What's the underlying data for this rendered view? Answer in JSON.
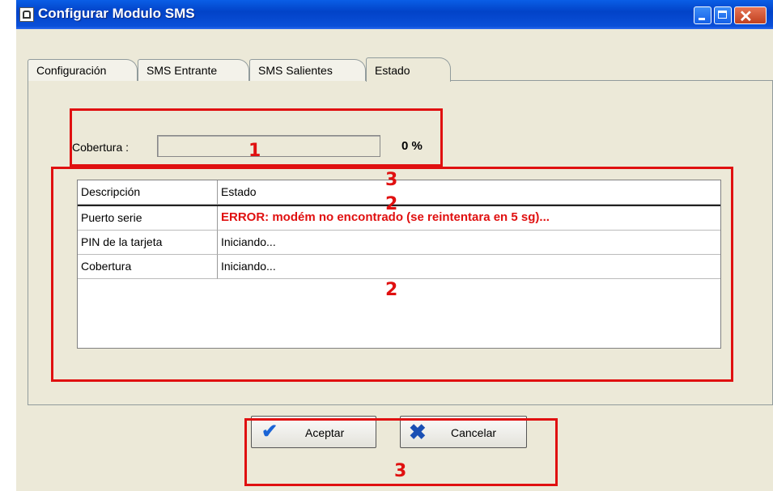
{
  "window": {
    "title": "Configurar Modulo SMS",
    "close_glyph": "✕"
  },
  "tabs": [
    {
      "label": "Configuración"
    },
    {
      "label": "SMS Entrante"
    },
    {
      "label": "SMS Salientes"
    },
    {
      "label": "Estado",
      "active": true
    }
  ],
  "cobertura": {
    "label": "Cobertura :",
    "value_percent": 0,
    "value_text": "0 %"
  },
  "grid": {
    "columns": [
      "Descripción",
      "Estado"
    ],
    "rows": [
      {
        "descripcion": "Puerto serie",
        "estado": "ERROR: modém no encontrado (se reintentara en 5 sg)...",
        "error": true
      },
      {
        "descripcion": "PIN de la tarjeta",
        "estado": "Iniciando..."
      },
      {
        "descripcion": "Cobertura",
        "estado": "Iniciando..."
      }
    ]
  },
  "buttons": {
    "accept": {
      "label": "Aceptar",
      "icon": "check-icon",
      "glyph": "✔"
    },
    "cancel": {
      "label": "Cancelar",
      "icon": "x-icon",
      "glyph": "✖"
    }
  },
  "annotations": {
    "colors": {
      "marker": "#e01010"
    },
    "labels": [
      "1",
      "3",
      "2",
      "2",
      "3"
    ]
  }
}
